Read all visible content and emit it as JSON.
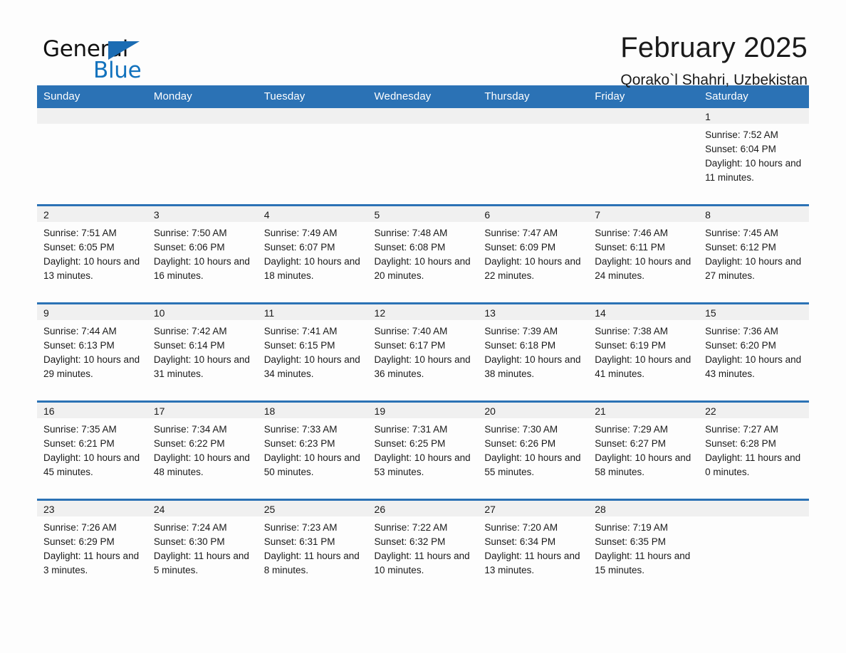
{
  "logo": {
    "word_one": "General",
    "word_two": "Blue",
    "flag_icon": "triangle-flag-icon",
    "colors": {
      "blue": "#1272bd",
      "flag_blue": "#1b6cb3",
      "black": "#111111"
    }
  },
  "header": {
    "title": "February 2025",
    "subtitle": "Qorako`l Shahri, Uzbekistan"
  },
  "theme": {
    "header_blue": "#2b72b5",
    "daynum_band": "#f0f0f0",
    "page_background": "#fdfdfd",
    "text": "#1a1a1a"
  },
  "calendar": {
    "weekday_headers": [
      "Sunday",
      "Monday",
      "Tuesday",
      "Wednesday",
      "Thursday",
      "Friday",
      "Saturday"
    ],
    "labels": {
      "sunrise_prefix": "Sunrise:",
      "sunset_prefix": "Sunset:",
      "daylight_prefix": "Daylight:"
    },
    "weeks": [
      [
        {
          "day": "",
          "empty": true
        },
        {
          "day": "",
          "empty": true
        },
        {
          "day": "",
          "empty": true
        },
        {
          "day": "",
          "empty": true
        },
        {
          "day": "",
          "empty": true
        },
        {
          "day": "",
          "empty": true
        },
        {
          "day": "1",
          "sunrise": "Sunrise: 7:52 AM",
          "sunset": "Sunset: 6:04 PM",
          "daylight": "Daylight: 10 hours and 11 minutes."
        }
      ],
      [
        {
          "day": "2",
          "sunrise": "Sunrise: 7:51 AM",
          "sunset": "Sunset: 6:05 PM",
          "daylight": "Daylight: 10 hours and 13 minutes."
        },
        {
          "day": "3",
          "sunrise": "Sunrise: 7:50 AM",
          "sunset": "Sunset: 6:06 PM",
          "daylight": "Daylight: 10 hours and 16 minutes."
        },
        {
          "day": "4",
          "sunrise": "Sunrise: 7:49 AM",
          "sunset": "Sunset: 6:07 PM",
          "daylight": "Daylight: 10 hours and 18 minutes."
        },
        {
          "day": "5",
          "sunrise": "Sunrise: 7:48 AM",
          "sunset": "Sunset: 6:08 PM",
          "daylight": "Daylight: 10 hours and 20 minutes."
        },
        {
          "day": "6",
          "sunrise": "Sunrise: 7:47 AM",
          "sunset": "Sunset: 6:09 PM",
          "daylight": "Daylight: 10 hours and 22 minutes."
        },
        {
          "day": "7",
          "sunrise": "Sunrise: 7:46 AM",
          "sunset": "Sunset: 6:11 PM",
          "daylight": "Daylight: 10 hours and 24 minutes."
        },
        {
          "day": "8",
          "sunrise": "Sunrise: 7:45 AM",
          "sunset": "Sunset: 6:12 PM",
          "daylight": "Daylight: 10 hours and 27 minutes."
        }
      ],
      [
        {
          "day": "9",
          "sunrise": "Sunrise: 7:44 AM",
          "sunset": "Sunset: 6:13 PM",
          "daylight": "Daylight: 10 hours and 29 minutes."
        },
        {
          "day": "10",
          "sunrise": "Sunrise: 7:42 AM",
          "sunset": "Sunset: 6:14 PM",
          "daylight": "Daylight: 10 hours and 31 minutes."
        },
        {
          "day": "11",
          "sunrise": "Sunrise: 7:41 AM",
          "sunset": "Sunset: 6:15 PM",
          "daylight": "Daylight: 10 hours and 34 minutes."
        },
        {
          "day": "12",
          "sunrise": "Sunrise: 7:40 AM",
          "sunset": "Sunset: 6:17 PM",
          "daylight": "Daylight: 10 hours and 36 minutes."
        },
        {
          "day": "13",
          "sunrise": "Sunrise: 7:39 AM",
          "sunset": "Sunset: 6:18 PM",
          "daylight": "Daylight: 10 hours and 38 minutes."
        },
        {
          "day": "14",
          "sunrise": "Sunrise: 7:38 AM",
          "sunset": "Sunset: 6:19 PM",
          "daylight": "Daylight: 10 hours and 41 minutes."
        },
        {
          "day": "15",
          "sunrise": "Sunrise: 7:36 AM",
          "sunset": "Sunset: 6:20 PM",
          "daylight": "Daylight: 10 hours and 43 minutes."
        }
      ],
      [
        {
          "day": "16",
          "sunrise": "Sunrise: 7:35 AM",
          "sunset": "Sunset: 6:21 PM",
          "daylight": "Daylight: 10 hours and 45 minutes."
        },
        {
          "day": "17",
          "sunrise": "Sunrise: 7:34 AM",
          "sunset": "Sunset: 6:22 PM",
          "daylight": "Daylight: 10 hours and 48 minutes."
        },
        {
          "day": "18",
          "sunrise": "Sunrise: 7:33 AM",
          "sunset": "Sunset: 6:23 PM",
          "daylight": "Daylight: 10 hours and 50 minutes."
        },
        {
          "day": "19",
          "sunrise": "Sunrise: 7:31 AM",
          "sunset": "Sunset: 6:25 PM",
          "daylight": "Daylight: 10 hours and 53 minutes."
        },
        {
          "day": "20",
          "sunrise": "Sunrise: 7:30 AM",
          "sunset": "Sunset: 6:26 PM",
          "daylight": "Daylight: 10 hours and 55 minutes."
        },
        {
          "day": "21",
          "sunrise": "Sunrise: 7:29 AM",
          "sunset": "Sunset: 6:27 PM",
          "daylight": "Daylight: 10 hours and 58 minutes."
        },
        {
          "day": "22",
          "sunrise": "Sunrise: 7:27 AM",
          "sunset": "Sunset: 6:28 PM",
          "daylight": "Daylight: 11 hours and 0 minutes."
        }
      ],
      [
        {
          "day": "23",
          "sunrise": "Sunrise: 7:26 AM",
          "sunset": "Sunset: 6:29 PM",
          "daylight": "Daylight: 11 hours and 3 minutes."
        },
        {
          "day": "24",
          "sunrise": "Sunrise: 7:24 AM",
          "sunset": "Sunset: 6:30 PM",
          "daylight": "Daylight: 11 hours and 5 minutes."
        },
        {
          "day": "25",
          "sunrise": "Sunrise: 7:23 AM",
          "sunset": "Sunset: 6:31 PM",
          "daylight": "Daylight: 11 hours and 8 minutes."
        },
        {
          "day": "26",
          "sunrise": "Sunrise: 7:22 AM",
          "sunset": "Sunset: 6:32 PM",
          "daylight": "Daylight: 11 hours and 10 minutes."
        },
        {
          "day": "27",
          "sunrise": "Sunrise: 7:20 AM",
          "sunset": "Sunset: 6:34 PM",
          "daylight": "Daylight: 11 hours and 13 minutes."
        },
        {
          "day": "28",
          "sunrise": "Sunrise: 7:19 AM",
          "sunset": "Sunset: 6:35 PM",
          "daylight": "Daylight: 11 hours and 15 minutes."
        },
        {
          "day": "",
          "empty": true
        }
      ]
    ]
  }
}
